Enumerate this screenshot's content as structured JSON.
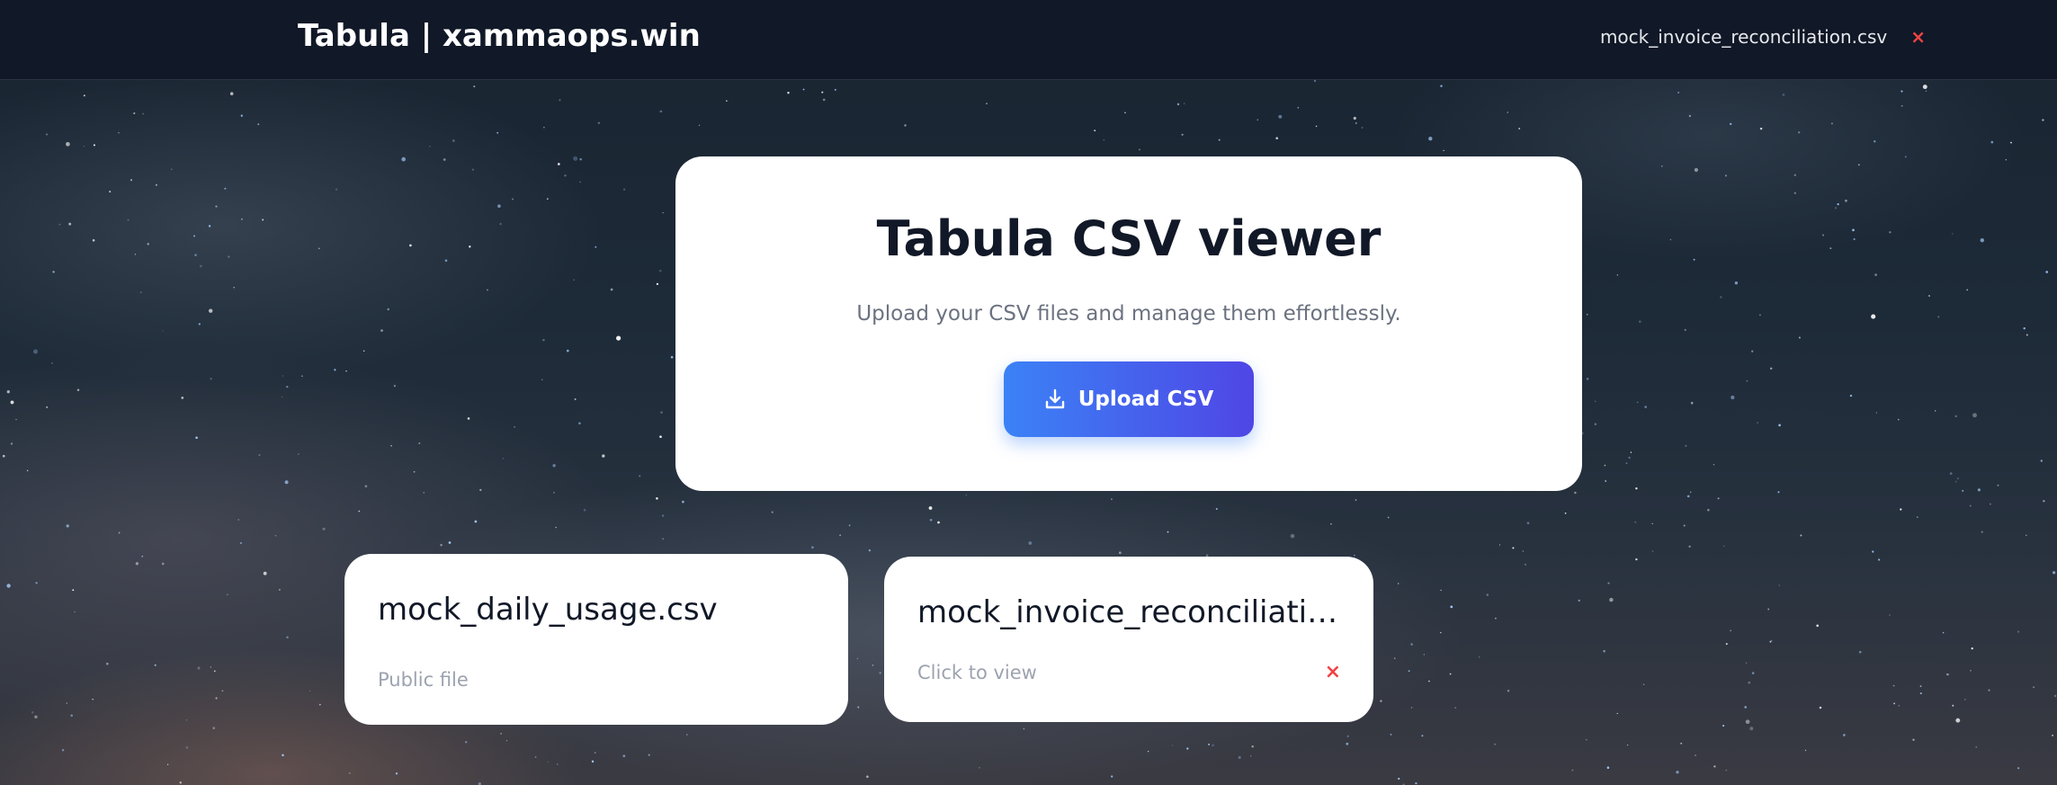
{
  "header": {
    "brand": "Tabula | xammaops.win",
    "open_file": "mock_invoice_reconciliation.csv",
    "close_symbol": "×"
  },
  "hero": {
    "title": "Tabula CSV viewer",
    "subtitle": "Upload your CSV files and manage them effortlessly.",
    "upload_label": "Upload CSV",
    "upload_icon": "upload-icon"
  },
  "files": [
    {
      "name": "mock_daily_usage.csv",
      "status": "Public file"
    },
    {
      "name": "mock_invoice_reconciliatio...",
      "status": "Click to view",
      "close_symbol": "×"
    }
  ],
  "colors": {
    "accent_start": "#3b82f6",
    "accent_end": "#4f46e5",
    "danger": "#ef4444",
    "topbar": "#111827"
  }
}
